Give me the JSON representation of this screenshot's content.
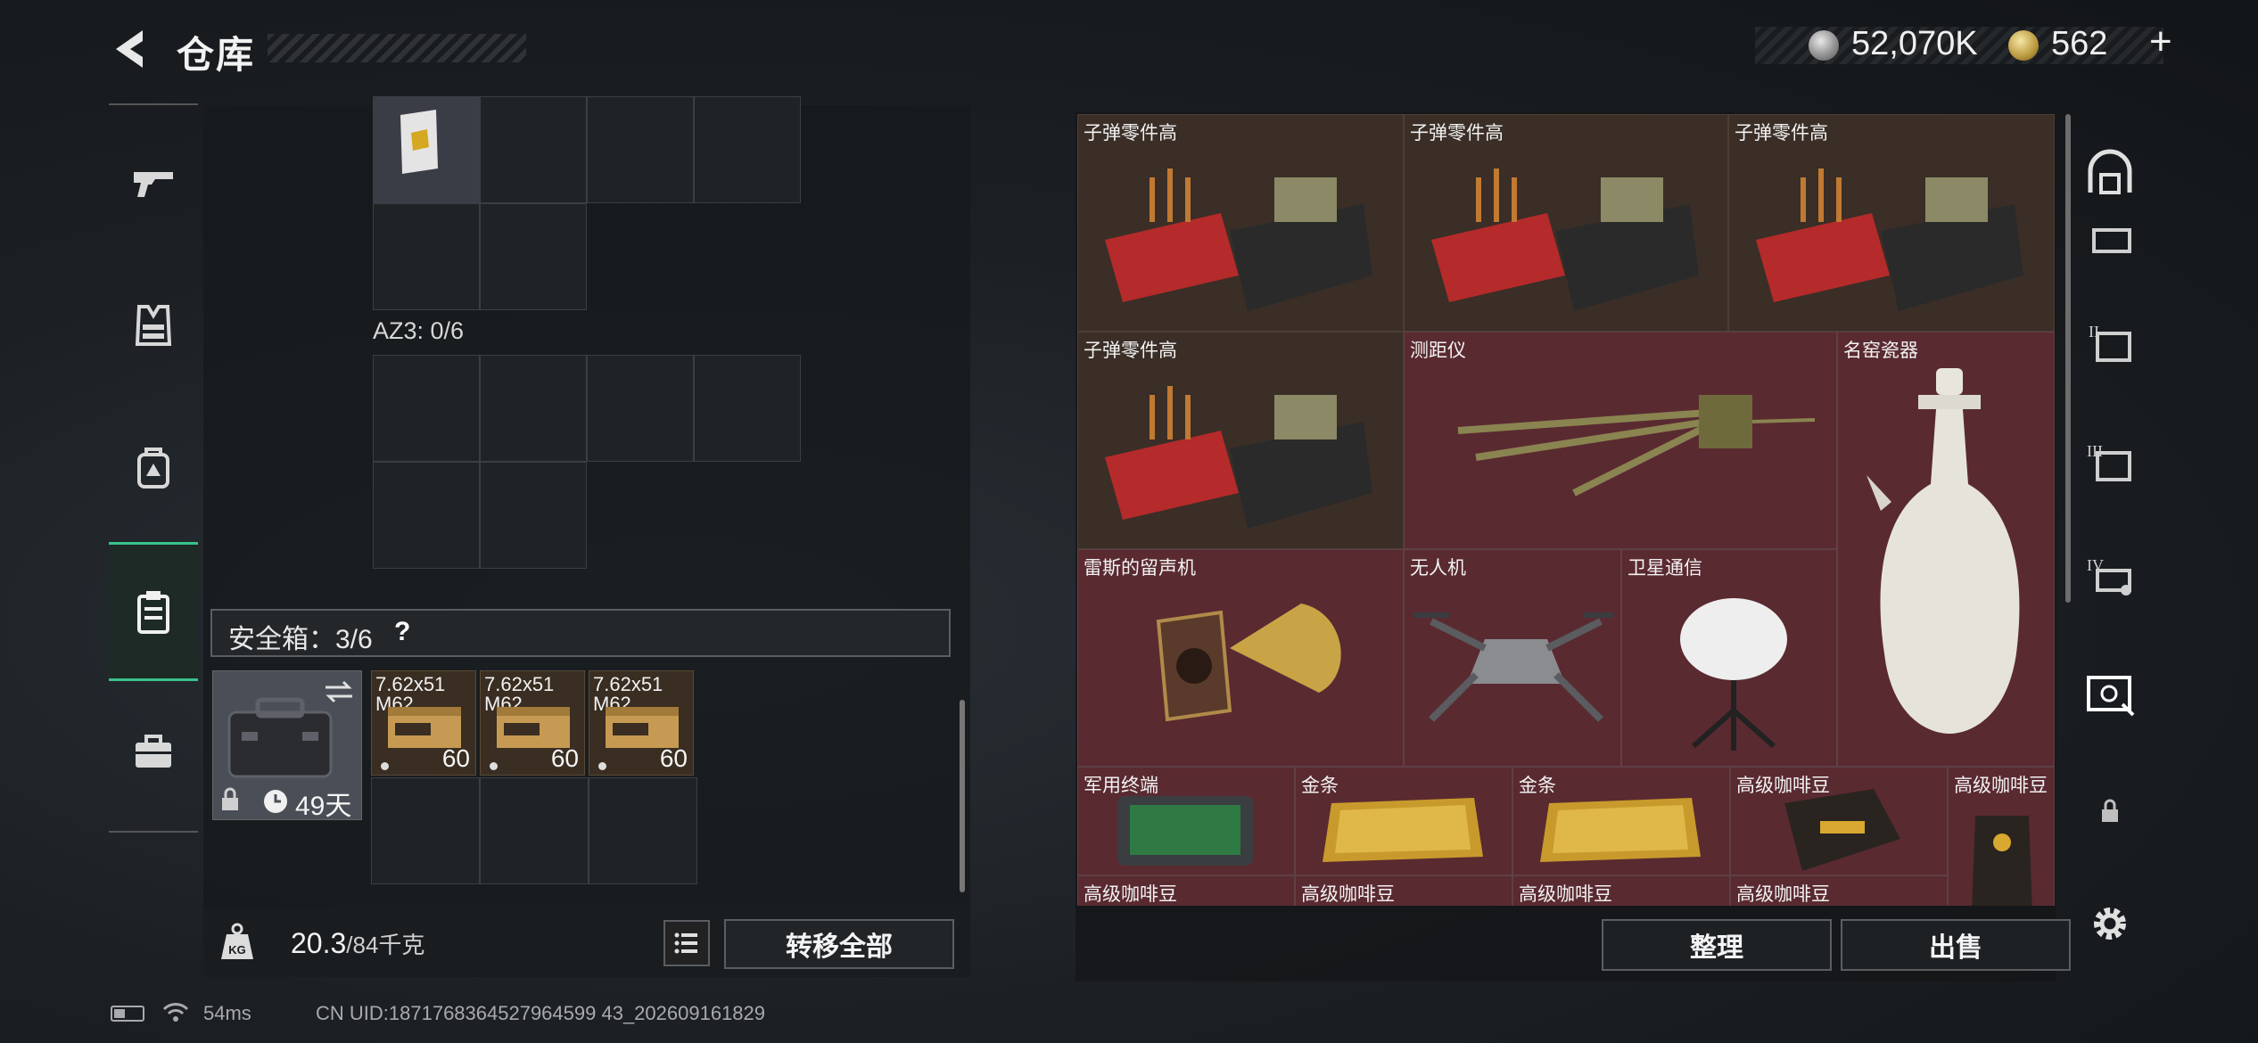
{
  "header": {
    "title": "仓库",
    "silver_amount": "52,070K",
    "gold_amount": "562",
    "plus": "+"
  },
  "left_panel": {
    "az_label": "AZ3: 0/6",
    "safe_box_label": "安全箱：3/6",
    "help": "?",
    "case_days": "49天",
    "ammo": [
      {
        "name": "7.62x51 M62",
        "count": "60"
      },
      {
        "name": "7.62x51 M62",
        "count": "60"
      },
      {
        "name": "7.62x51 M62",
        "count": "60"
      }
    ],
    "weight_current": "20.3",
    "weight_max": "/84千克",
    "transfer_all": "转移全部"
  },
  "storage": {
    "items": [
      {
        "label": "子弹零件高",
        "variant": "brown"
      },
      {
        "label": "子弹零件高",
        "variant": "brown"
      },
      {
        "label": "子弹零件高",
        "variant": "brown"
      },
      {
        "label": "子弹零件高",
        "variant": "brown"
      },
      {
        "label": "测距仪",
        "variant": "red"
      },
      {
        "label": "名窑瓷器",
        "variant": "red"
      },
      {
        "label": "雷斯的留声机",
        "variant": "red"
      },
      {
        "label": "无人机",
        "variant": "red"
      },
      {
        "label": "卫星通信",
        "variant": "red"
      },
      {
        "label": "军用终端",
        "variant": "red"
      },
      {
        "label": "金条",
        "variant": "red"
      },
      {
        "label": "金条",
        "variant": "red"
      },
      {
        "label": "高级咖啡豆",
        "variant": "red"
      },
      {
        "label": "高级咖啡豆",
        "variant": "red"
      },
      {
        "label": "高级咖啡豆",
        "variant": "red"
      },
      {
        "label": "高级咖啡豆",
        "variant": "red"
      },
      {
        "label": "高级咖啡豆",
        "variant": "red"
      },
      {
        "label": "高级咖啡豆",
        "variant": "red"
      }
    ],
    "sort": "整理",
    "sell": "出售"
  },
  "side_tabs": {
    "left": [
      "gun-icon",
      "vest-icon",
      "backpack-icon",
      "clipboard-icon",
      "briefcase-icon"
    ],
    "right": [
      "bunker-icon",
      "storage-i-icon",
      "storage-ii-icon",
      "storage-iii-icon",
      "storage-iv-icon",
      "safe-icon",
      "lock-icon"
    ]
  },
  "status": {
    "ping": "54ms",
    "uid": "CN UID:1871768364527964599 43_202609161829"
  },
  "colors": {
    "accent_green": "#38c28c",
    "tile_red": "#5a2a31",
    "tile_brown": "#3a2e27"
  }
}
